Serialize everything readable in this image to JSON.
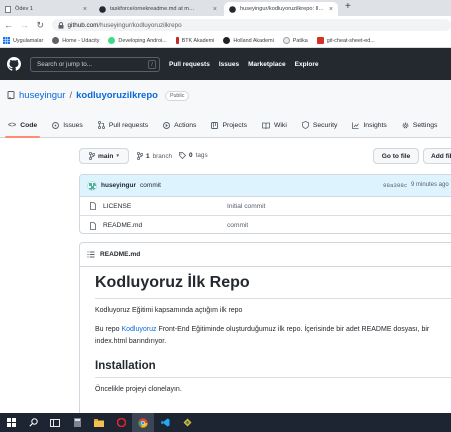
{
  "browser": {
    "tabs": [
      {
        "title": "Ödev 1"
      },
      {
        "title": "taskforce/ornekreadme.md at m…"
      },
      {
        "title": "huseyingur/kodluyoruzilkrepo: İl…"
      }
    ],
    "new_tab_label": "+",
    "url_host": "github.com",
    "url_path": "/huseyingur/kodluyoruzilkrepo",
    "bookmarks": [
      {
        "label": "Uygulamalar"
      },
      {
        "label": "Home - Udacity"
      },
      {
        "label": "Developing Androi..."
      },
      {
        "label": "BTK Akademi"
      },
      {
        "label": "Holland Akademi"
      },
      {
        "label": "Patika"
      },
      {
        "label": "git-cheat-sheet-ed..."
      }
    ]
  },
  "github_header": {
    "search_placeholder": "Search or jump to...",
    "search_key": "/",
    "nav": [
      "Pull requests",
      "Issues",
      "Marketplace",
      "Explore"
    ]
  },
  "repo": {
    "owner": "huseyingur",
    "separator": "/",
    "name": "kodluyoruzilkrepo",
    "visibility": "Public",
    "tabs": [
      {
        "label": "Code",
        "icon": "code-icon"
      },
      {
        "label": "Issues",
        "icon": "issue-icon"
      },
      {
        "label": "Pull requests",
        "icon": "pull-request-icon"
      },
      {
        "label": "Actions",
        "icon": "actions-icon"
      },
      {
        "label": "Projects",
        "icon": "projects-icon"
      },
      {
        "label": "Wiki",
        "icon": "book-icon"
      },
      {
        "label": "Security",
        "icon": "shield-icon"
      },
      {
        "label": "Insights",
        "icon": "graph-icon"
      },
      {
        "label": "Settings",
        "icon": "gear-icon"
      }
    ]
  },
  "branch_bar": {
    "branch": "main",
    "branch_count": "1",
    "branch_word": "branch",
    "tag_count": "0",
    "tag_word": "tags",
    "goto_file": "Go to file",
    "add_file": "Add fil"
  },
  "commit": {
    "author": "huseyingur",
    "message": "commit",
    "sha": "98a398c",
    "time": "9 minutes ago"
  },
  "files": [
    {
      "name": "LICENSE",
      "commit_message": "Initial commit"
    },
    {
      "name": "README.md",
      "commit_message": "commit"
    }
  ],
  "readme": {
    "filename": "README.md",
    "title": "Kodluyoruz İlk Repo",
    "para1": "Kodluyoruz Eğitimi kapsamında açtığım ilk repo",
    "para2_before": "Bu repo ",
    "para2_link": "Kodluyoruz",
    "para2_after": " Front-End Eğitiminde oluşturduğumuz ilk repo. İçerisinde bir adet README dosyası, bir",
    "para2_line2": "index.html barındırıyor.",
    "h2": "Installation",
    "para3": "Öncelikle projeyi clonelayın."
  },
  "colors": {
    "header_bg": "#24292f",
    "link": "#0969da",
    "tab_underline": "#fd8c73",
    "commit_bar_bg": "#ddf4ff",
    "taskbar_bg": "#1d2533"
  }
}
